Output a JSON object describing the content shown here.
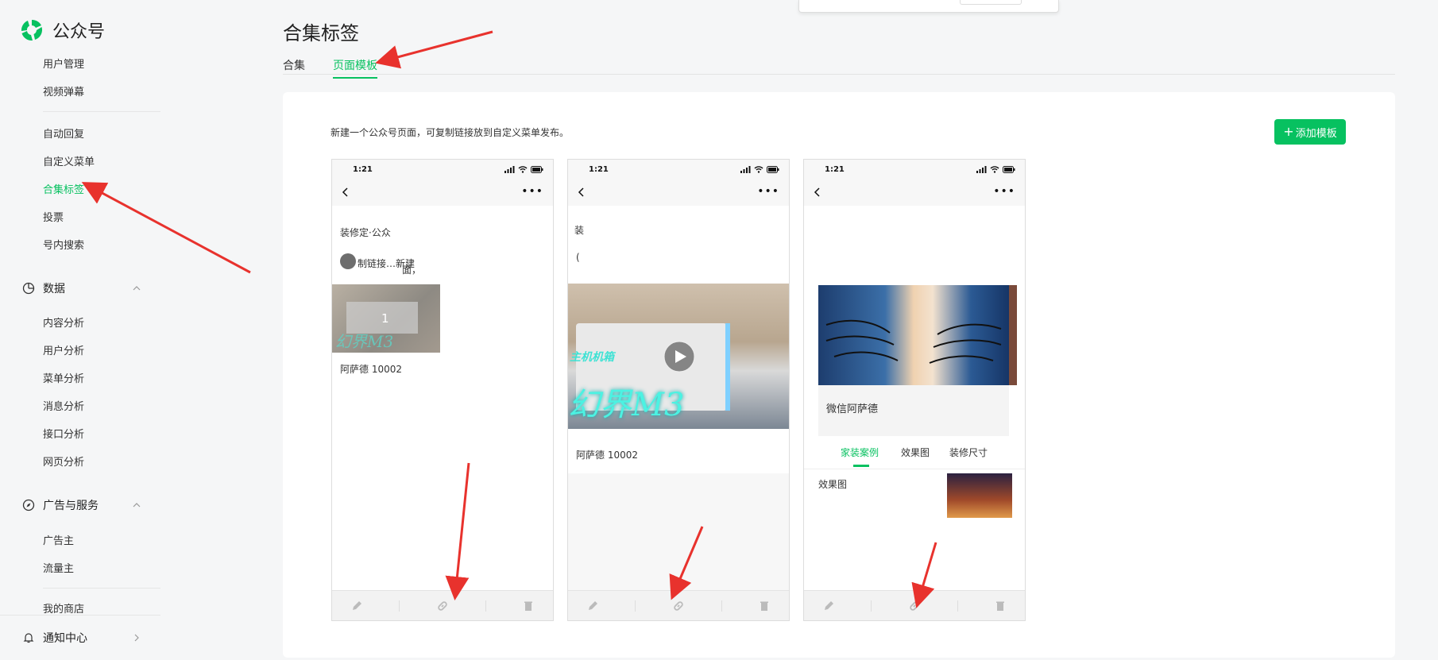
{
  "app": {
    "name": "公众号",
    "brand_color": "#07c160"
  },
  "sidebar": {
    "items_top": [
      "用户管理",
      "视频弹幕"
    ],
    "items_func": [
      "自动回复",
      "自定义菜单",
      "合集标签",
      "投票",
      "号内搜索"
    ],
    "active_item": "合集标签",
    "group_data": {
      "label": "数据",
      "icon": "clock-chart-icon"
    },
    "items_data": [
      "内容分析",
      "用户分析",
      "菜单分析",
      "消息分析",
      "接口分析",
      "网页分析"
    ],
    "group_ads": {
      "label": "广告与服务",
      "icon": "compass-icon"
    },
    "items_ads": [
      "广告主",
      "流量主"
    ],
    "item_shop": "我的商店",
    "notify": {
      "label": "通知中心",
      "icon": "bell-icon"
    }
  },
  "main": {
    "title": "合集标签",
    "tabs": [
      {
        "label": "合集"
      },
      {
        "label": "页面模板",
        "active": true
      }
    ],
    "description": "新建一个公众号页面，可复制链接放到自定义菜单发布。",
    "add_button": "添加模板"
  },
  "templates": [
    {
      "time": "1:21",
      "header_line1": "装修定·公众",
      "header_line2": "制链接…新建",
      "header_line2_tail": "面，",
      "thumb_number": "1",
      "thumb_overlay": "幻界M3",
      "caption": "阿萨德 10002"
    },
    {
      "time": "1:21",
      "side_text_1": "装",
      "side_text_2": "(",
      "video_overlay_top": "主机机箱",
      "video_overlay_big": "幻界M3",
      "caption": "阿萨德 10002"
    },
    {
      "time": "1:21",
      "card_title": "微信阿萨德",
      "tabs": [
        "家装案例",
        "效果图",
        "装修尺寸"
      ],
      "active_tab": "家装案例",
      "list_item_label": "效果图"
    }
  ],
  "footer_icons": [
    "edit-icon",
    "link-icon",
    "delete-icon"
  ]
}
